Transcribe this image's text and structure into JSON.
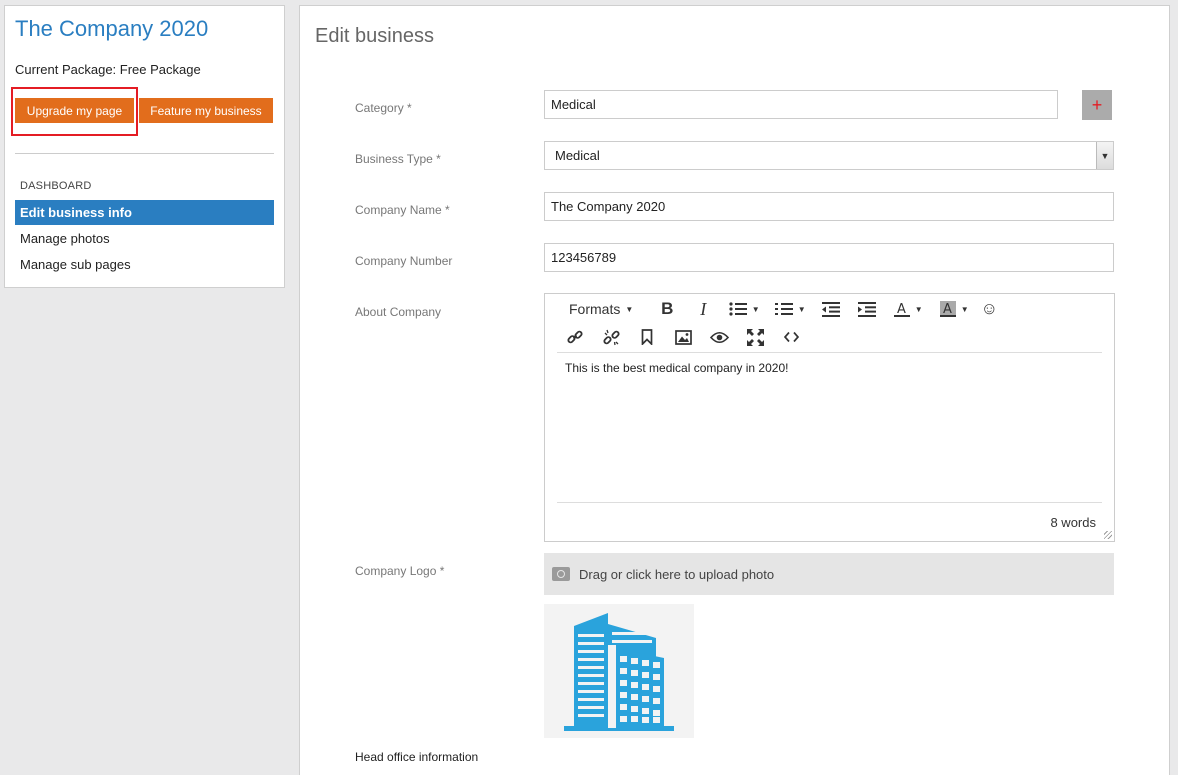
{
  "sidebar": {
    "company_title": "The Company 2020",
    "package_text": "Current Package: Free Package",
    "upgrade_label": "Upgrade my page",
    "feature_label": "Feature my business",
    "nav_heading": "DASHBOARD",
    "nav_items": [
      {
        "label": "Edit business info",
        "active": true
      },
      {
        "label": "Manage photos",
        "active": false
      },
      {
        "label": "Manage sub pages",
        "active": false
      }
    ]
  },
  "main": {
    "title": "Edit business",
    "fields": {
      "category": {
        "label": "Category *",
        "value": "Medical"
      },
      "business_type": {
        "label": "Business Type *",
        "value": "Medical"
      },
      "company_name": {
        "label": "Company Name *",
        "value": "The Company 2020"
      },
      "company_number": {
        "label": "Company Number",
        "value": "123456789"
      },
      "about": {
        "label": "About Company",
        "content": "This is the best medical company in 2020!",
        "word_count": "8 words"
      },
      "logo": {
        "label": "Company Logo *",
        "upload_text": "Drag or click here to upload photo"
      }
    },
    "editor_toolbar": {
      "formats_label": "Formats",
      "bold": "B",
      "italic": "I"
    },
    "head_office_heading": "Head office information"
  },
  "colors": {
    "accent_blue": "#2a7ec1",
    "button_orange": "#e26d1c",
    "highlight_red": "#e41c24",
    "logo_blue": "#2aa3dc"
  }
}
